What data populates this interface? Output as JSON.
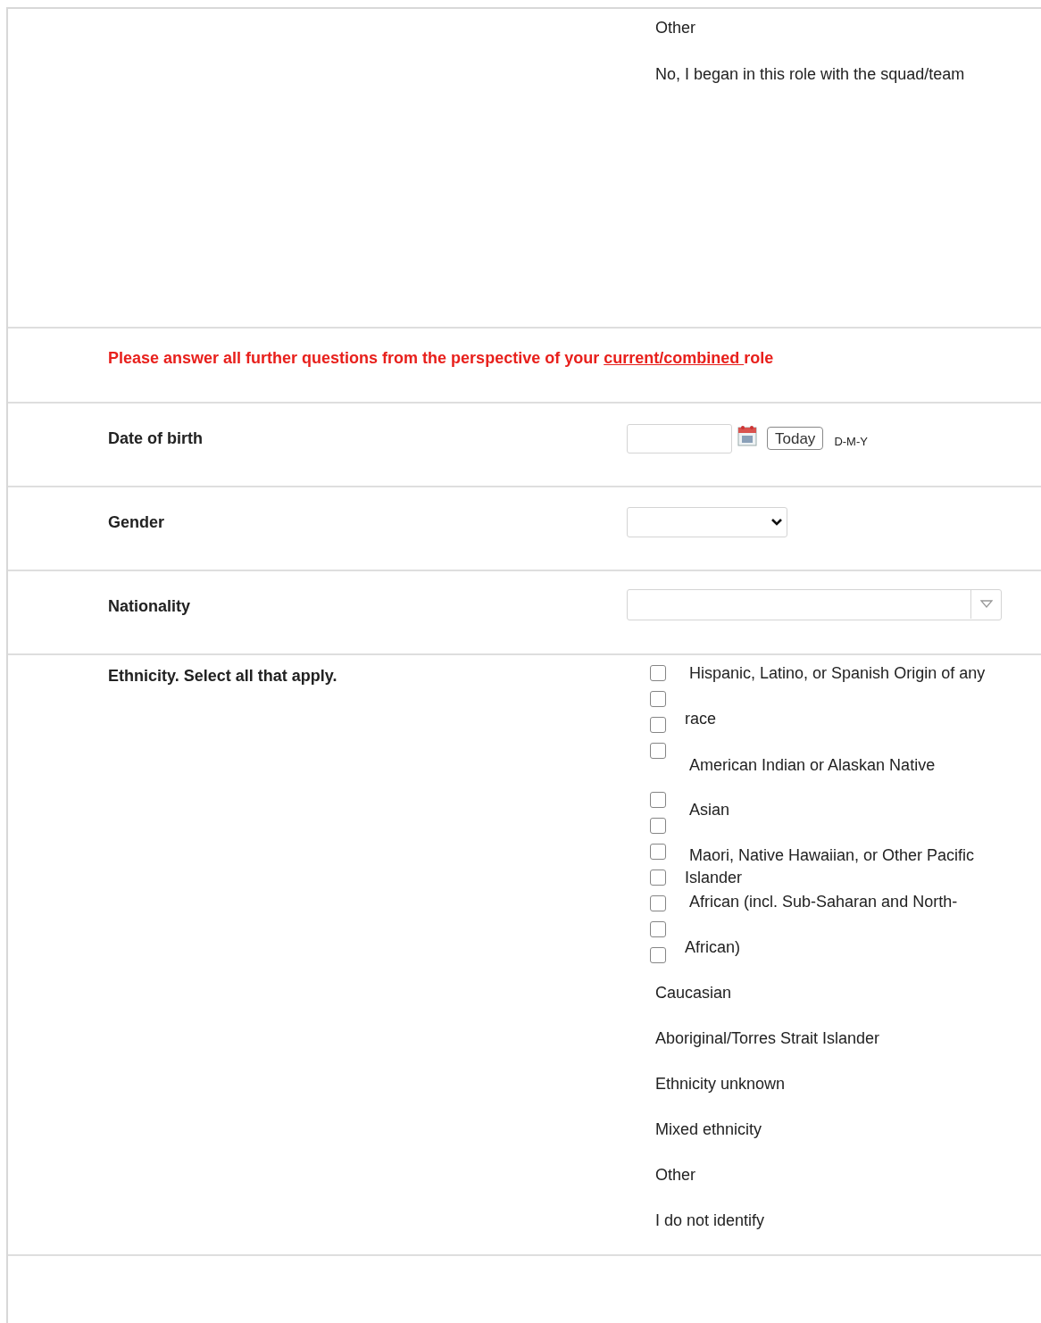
{
  "previous_question": {
    "options": [
      "Other",
      "No, I began in this role with the squad/team"
    ]
  },
  "notice": {
    "before": "Please answer all further questions from the perspective of your ",
    "link": "current/combined ",
    "after": "role"
  },
  "fields": [
    {
      "kind": "date",
      "label": "Date of birth",
      "button": "Today",
      "format": "D-M-Y"
    },
    {
      "kind": "select",
      "label": "Gender"
    },
    {
      "kind": "combo",
      "label": "Nationality"
    }
  ],
  "ethnicity": {
    "label": "Ethnicity. Select all that apply.",
    "checkboxes": [
      {
        "checked": false
      },
      {
        "checked": false
      },
      {
        "checked": false
      },
      {
        "checked": false
      },
      {
        "checked": false
      },
      {
        "checked": false
      },
      {
        "checked": false
      },
      {
        "checked": false
      },
      {
        "checked": false
      },
      {
        "checked": false
      },
      {
        "checked": false
      }
    ],
    "option_lines": [
      "Hispanic, Latino, or Spanish Origin of any",
      "race",
      "American Indian or Alaskan Native",
      "Asian",
      "Maori, Native Hawaiian, or Other Pacific",
      "Islander",
      "African (incl. Sub-Saharan and North-",
      "African)",
      "Caucasian",
      "Aboriginal/Torres Strait Islander",
      "Ethnicity unknown",
      "Mixed ethnicity",
      "Other",
      "I do not identify"
    ]
  }
}
